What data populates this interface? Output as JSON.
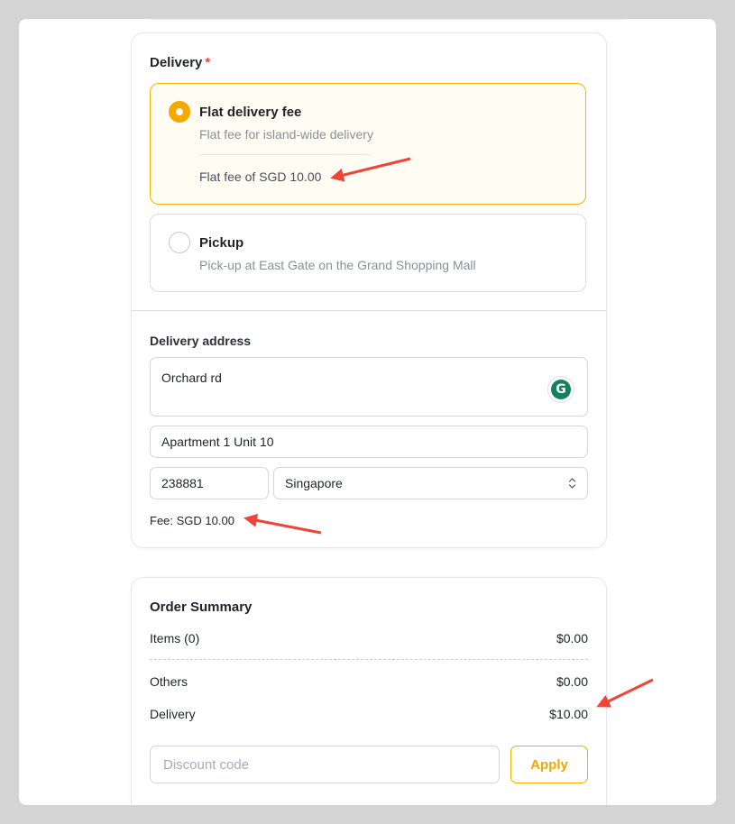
{
  "delivery": {
    "title": "Delivery",
    "required_mark": "*",
    "options": [
      {
        "title": "Flat delivery fee",
        "description": "Flat fee for island-wide delivery",
        "fee_text": "Flat fee of SGD 10.00",
        "selected": true
      },
      {
        "title": "Pickup",
        "description": "Pick-up at East Gate on the Grand Shopping Mall",
        "selected": false
      }
    ],
    "address": {
      "label": "Delivery address",
      "line1": "Orchard rd",
      "line2": "Apartment 1 Unit 10",
      "postal_code": "238881",
      "country": "Singapore",
      "fee_text": "Fee: SGD 10.00"
    }
  },
  "summary": {
    "title": "Order Summary",
    "items_label": "Items (0)",
    "items_value": "$0.00",
    "others_label": "Others",
    "others_value": "$0.00",
    "delivery_label": "Delivery",
    "delivery_value": "$10.00",
    "discount_placeholder": "Discount code",
    "apply_label": "Apply"
  },
  "icons": {
    "grammarly": "G"
  },
  "colors": {
    "accent": "#f5a800",
    "annotation_arrow": "#f04438",
    "required": "#e5484d"
  }
}
